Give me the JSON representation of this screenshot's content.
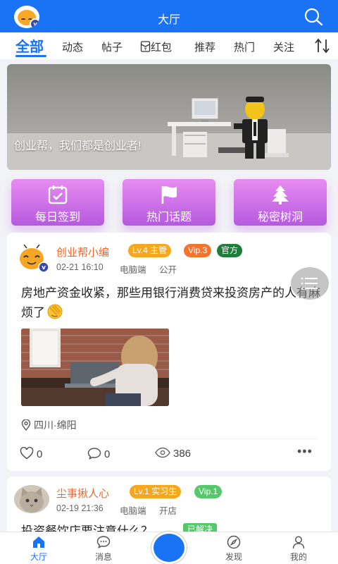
{
  "header": {
    "title": "大厅",
    "logo_badge": "v",
    "search_icon": "search-icon"
  },
  "tabs": [
    {
      "label": "全部",
      "active": true
    },
    {
      "label": "动态"
    },
    {
      "label": "帖子"
    },
    {
      "label": "红包",
      "icon": "red-packet-icon"
    },
    {
      "label": "推荐"
    },
    {
      "label": "热门"
    },
    {
      "label": "关注"
    }
  ],
  "banner": {
    "caption": "创业帮，我们都是创业者!"
  },
  "quick_actions": [
    {
      "label": "每日签到",
      "icon": "calendar-check-icon"
    },
    {
      "label": "热门话题",
      "icon": "flag-icon"
    },
    {
      "label": "秘密树洞",
      "icon": "tree-icon"
    }
  ],
  "posts": [
    {
      "author": "创业帮小编",
      "badges": [
        {
          "text": "Lv.4 主管",
          "color": "#f5a81f"
        },
        {
          "text": "Vip.3",
          "color": "#f5732b"
        },
        {
          "text": "官方",
          "color": "#1f7d3a"
        }
      ],
      "date": "02-21 16:10",
      "device": "电脑端",
      "visibility": "公开",
      "content": "房地产资金收紧，那些用银行消费贷来投资房产的人有麻烦了",
      "location": "四川·绵阳",
      "likes": "0",
      "comments": "0",
      "views": "386"
    },
    {
      "author": "尘事揪人心",
      "badges": [
        {
          "text": "Lv.1 实习生",
          "color": "#f5a81f"
        },
        {
          "text": "Vip.1",
          "color": "#56c76b"
        }
      ],
      "date": "02-19 21:36",
      "device": "电脑端",
      "visibility": "开店",
      "content": "投资餐饮店要注意什么？",
      "status": "已解决"
    }
  ],
  "bottom_nav": [
    {
      "label": "大厅",
      "icon": "home-icon",
      "active": true
    },
    {
      "label": "消息",
      "icon": "chat-icon"
    },
    {
      "label": "发现",
      "icon": "compass-icon"
    },
    {
      "label": "我的",
      "icon": "user-icon"
    }
  ],
  "colors": {
    "primary": "#1a72f5",
    "author": "#f0662d",
    "quick_action_gradient_top": "#e88bf0",
    "quick_action_gradient_bottom": "#b55ae0"
  }
}
